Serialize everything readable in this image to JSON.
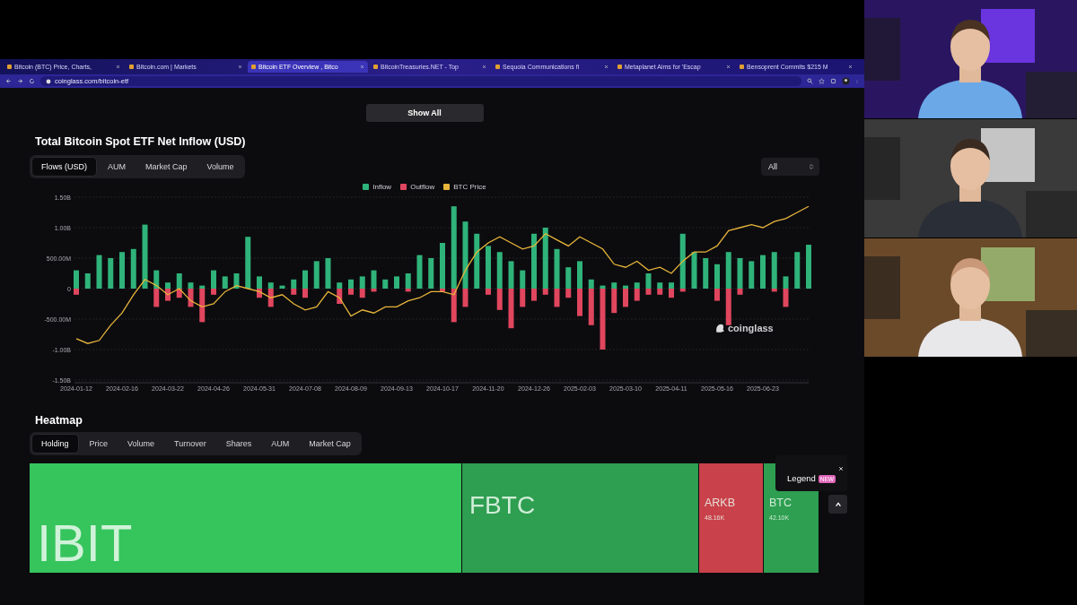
{
  "browser": {
    "tabs": [
      {
        "title": "Bitcoin (BTC) Price, Charts,",
        "selected": false
      },
      {
        "title": "Bitcoin.com | Markets",
        "selected": false
      },
      {
        "title": "Bitcoin ETF Overview , Bitco",
        "selected": true
      },
      {
        "title": "BitcoinTreasuries.NET - Top",
        "selected": false
      },
      {
        "title": "Sequoia Communications fi",
        "selected": false
      },
      {
        "title": "Metaplanet Aims for 'Escap",
        "selected": false
      },
      {
        "title": "Bensoprent Commits $215 M",
        "selected": false
      }
    ],
    "url": "coinglass.com/bitcoin-etf"
  },
  "page": {
    "show_all_button": "Show All",
    "flows": {
      "title": "Total Bitcoin Spot ETF Net Inflow (USD)",
      "tabs": [
        {
          "label": "Flows (USD)",
          "selected": true
        },
        {
          "label": "AUM",
          "selected": false
        },
        {
          "label": "Market Cap",
          "selected": false
        },
        {
          "label": "Volume",
          "selected": false
        }
      ],
      "range_select": "All",
      "watermark": "coinglass",
      "chart_data": {
        "type": "bar",
        "stacked": true,
        "grid": true,
        "ylim": [
          -1500000000.0,
          1500000000.0
        ],
        "yticks": [
          {
            "value": 1500000000.0,
            "label": "1.50B"
          },
          {
            "value": 1000000000.0,
            "label": "1.00B"
          },
          {
            "value": 500000000.0,
            "label": "500.00M"
          },
          {
            "value": 0,
            "label": "0"
          },
          {
            "value": -500000000.0,
            "label": "-500.00M"
          },
          {
            "value": -1000000000.0,
            "label": "-1.00B"
          },
          {
            "value": -1500000000.0,
            "label": "-1.50B"
          }
        ],
        "categories": [
          "2024-01-12",
          null,
          null,
          null,
          "2024-02-16",
          null,
          null,
          null,
          "2024-03-22",
          null,
          null,
          null,
          "2024-04-26",
          null,
          null,
          null,
          "2024-05-31",
          null,
          null,
          null,
          "2024-07-08",
          null,
          null,
          null,
          "2024-08-09",
          null,
          null,
          null,
          "2024-09-13",
          null,
          null,
          null,
          "2024-10-17",
          null,
          null,
          null,
          "2024-11-20",
          null,
          null,
          null,
          "2024-12-26",
          null,
          null,
          null,
          "2025-02-03",
          null,
          null,
          null,
          "2025-03-10",
          null,
          null,
          null,
          "2025-04-11",
          null,
          null,
          null,
          "2025-05-16",
          null,
          null,
          null,
          "2025-06-23",
          null,
          null,
          null,
          null
        ],
        "series": [
          {
            "name": "Inflow",
            "type": "bar",
            "color": "#2fb37a",
            "values": [
              300000000.0,
              250000000.0,
              550000000.0,
              500000000.0,
              600000000.0,
              650000000.0,
              1050000000.0,
              300000000.0,
              100000000.0,
              250000000.0,
              100000000.0,
              50000000.0,
              300000000.0,
              200000000.0,
              250000000.0,
              850000000.0,
              200000000.0,
              100000000.0,
              50000000.0,
              150000000.0,
              300000000.0,
              450000000.0,
              500000000.0,
              100000000.0,
              150000000.0,
              200000000.0,
              300000000.0,
              150000000.0,
              200000000.0,
              250000000.0,
              550000000.0,
              500000000.0,
              750000000.0,
              1350000000.0,
              1100000000.0,
              900000000.0,
              700000000.0,
              600000000.0,
              450000000.0,
              300000000.0,
              900000000.0,
              1000000000.0,
              650000000.0,
              350000000.0,
              450000000.0,
              150000000.0,
              50000000.0,
              100000000.0,
              50000000.0,
              100000000.0,
              250000000.0,
              100000000.0,
              100000000.0,
              900000000.0,
              600000000.0,
              500000000.0,
              400000000.0,
              600000000.0,
              500000000.0,
              450000000.0,
              550000000.0,
              600000000.0,
              200000000.0,
              600000000.0,
              720000000.0
            ]
          },
          {
            "name": "Outflow",
            "type": "bar",
            "color": "#e0465e",
            "values": [
              -100000000.0,
              null,
              null,
              null,
              null,
              null,
              null,
              -300000000.0,
              -200000000.0,
              -150000000.0,
              -300000000.0,
              -550000000.0,
              -100000000.0,
              null,
              null,
              null,
              -150000000.0,
              -300000000.0,
              null,
              -100000000.0,
              -150000000.0,
              null,
              null,
              -250000000.0,
              -100000000.0,
              -150000000.0,
              -50000000.0,
              null,
              null,
              -50000000.0,
              null,
              null,
              -50000000.0,
              -550000000.0,
              -300000000.0,
              null,
              -100000000.0,
              -350000000.0,
              -650000000.0,
              -300000000.0,
              -200000000.0,
              -100000000.0,
              -300000000.0,
              -150000000.0,
              -450000000.0,
              -600000000.0,
              -1000000000.0,
              -400000000.0,
              -300000000.0,
              -200000000.0,
              -100000000.0,
              -100000000.0,
              -150000000.0,
              -50000000.0,
              null,
              null,
              -200000000.0,
              -600000000.0,
              -100000000.0,
              null,
              null,
              -50000000.0,
              -300000000.0,
              null,
              null
            ]
          },
          {
            "name": "BTC Price",
            "type": "line",
            "color": "#e8b53a",
            "values": [
              -820000000.0,
              -900000000.0,
              -850000000.0,
              -600000000.0,
              -400000000.0,
              -100000000.0,
              150000000.0,
              50000000.0,
              -100000000.0,
              0,
              -200000000.0,
              -300000000.0,
              -250000000.0,
              -50000000.0,
              50000000.0,
              0,
              -50000000.0,
              -150000000.0,
              -100000000.0,
              -250000000.0,
              -350000000.0,
              -300000000.0,
              -50000000.0,
              -150000000.0,
              -450000000.0,
              -350000000.0,
              -400000000.0,
              -300000000.0,
              -300000000.0,
              -200000000.0,
              -150000000.0,
              -50000000.0,
              -50000000.0,
              -100000000.0,
              300000000.0,
              600000000.0,
              750000000.0,
              850000000.0,
              750000000.0,
              650000000.0,
              700000000.0,
              900000000.0,
              800000000.0,
              700000000.0,
              850000000.0,
              750000000.0,
              650000000.0,
              400000000.0,
              350000000.0,
              450000000.0,
              300000000.0,
              350000000.0,
              250000000.0,
              450000000.0,
              600000000.0,
              600000000.0,
              700000000.0,
              950000000.0,
              1000000000.0,
              1050000000.0,
              1000000000.0,
              1100000000.0,
              1150000000.0,
              1250000000.0,
              1350000000.0
            ]
          }
        ]
      }
    },
    "heatmap": {
      "title": "Heatmap",
      "tabs": [
        {
          "label": "Holding",
          "selected": true
        },
        {
          "label": "Price",
          "selected": false
        },
        {
          "label": "Volume",
          "selected": false
        },
        {
          "label": "Turnover",
          "selected": false
        },
        {
          "label": "Shares",
          "selected": false
        },
        {
          "label": "AUM",
          "selected": false
        },
        {
          "label": "Market Cap",
          "selected": false
        }
      ],
      "tiles": [
        {
          "label": "IBIT",
          "color": "#36c45c"
        },
        {
          "label": "FBTC",
          "color": "#2e9e50"
        },
        {
          "label": "ARKB",
          "value": "48.16K",
          "color": "#c9414a"
        },
        {
          "label": "BTC",
          "value": "42.10K",
          "color": "#2e9e50"
        }
      ],
      "legend_popup": {
        "label": "Legend",
        "badge": "NEW"
      }
    }
  }
}
